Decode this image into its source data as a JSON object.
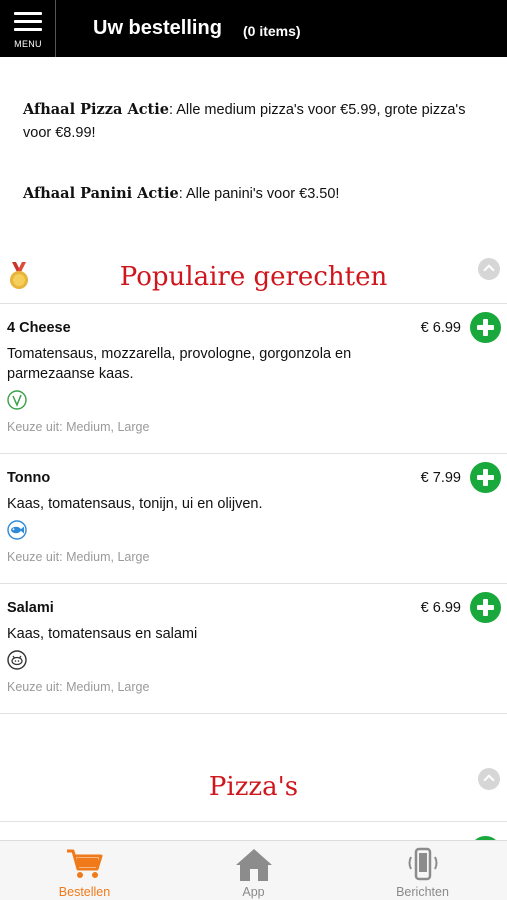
{
  "header": {
    "menu_label": "MENU",
    "title": "Uw bestelling",
    "item_count": "(0 items)"
  },
  "promos": [
    {
      "title": "Afhaal Pizza Actie",
      "text": ": Alle medium pizza's voor €5.99, grote pizza's voor €8.99!"
    },
    {
      "title": "Afhaal Panini Actie",
      "text": ": Alle panini's voor €3.50!"
    }
  ],
  "sections": [
    {
      "title": "Populaire gerechten",
      "icon": "medal-icon"
    },
    {
      "title": "Pizza's"
    }
  ],
  "items": [
    {
      "name": "4 Cheese",
      "price": "€ 6.99",
      "description": "Tomatensaus, mozzarella, provologne, gorgonzola en parmezaanse kaas.",
      "icon": "vegetarian-icon",
      "choice": "Keuze uit: Medium, Large"
    },
    {
      "name": "Tonno",
      "price": "€ 7.99",
      "description": "Kaas, tomatensaus, tonijn, ui en olijven.",
      "icon": "fish-icon",
      "choice": "Keuze uit: Medium, Large"
    },
    {
      "name": "Salami",
      "price": "€ 6.99",
      "description": "Kaas, tomatensaus en salami",
      "icon": "pork-icon",
      "choice": "Keuze uit: Medium, Large"
    }
  ],
  "nav": {
    "items": [
      {
        "label": "Bestellen",
        "icon": "cart-icon",
        "active": true
      },
      {
        "label": "App",
        "icon": "home-icon",
        "active": false
      },
      {
        "label": "Berichten",
        "icon": "phone-message-icon",
        "active": false
      }
    ]
  },
  "colors": {
    "header_bg": "#000000",
    "section_title": "#d0161d",
    "add_button": "#18a83c",
    "nav_active": "#f07a1a"
  }
}
